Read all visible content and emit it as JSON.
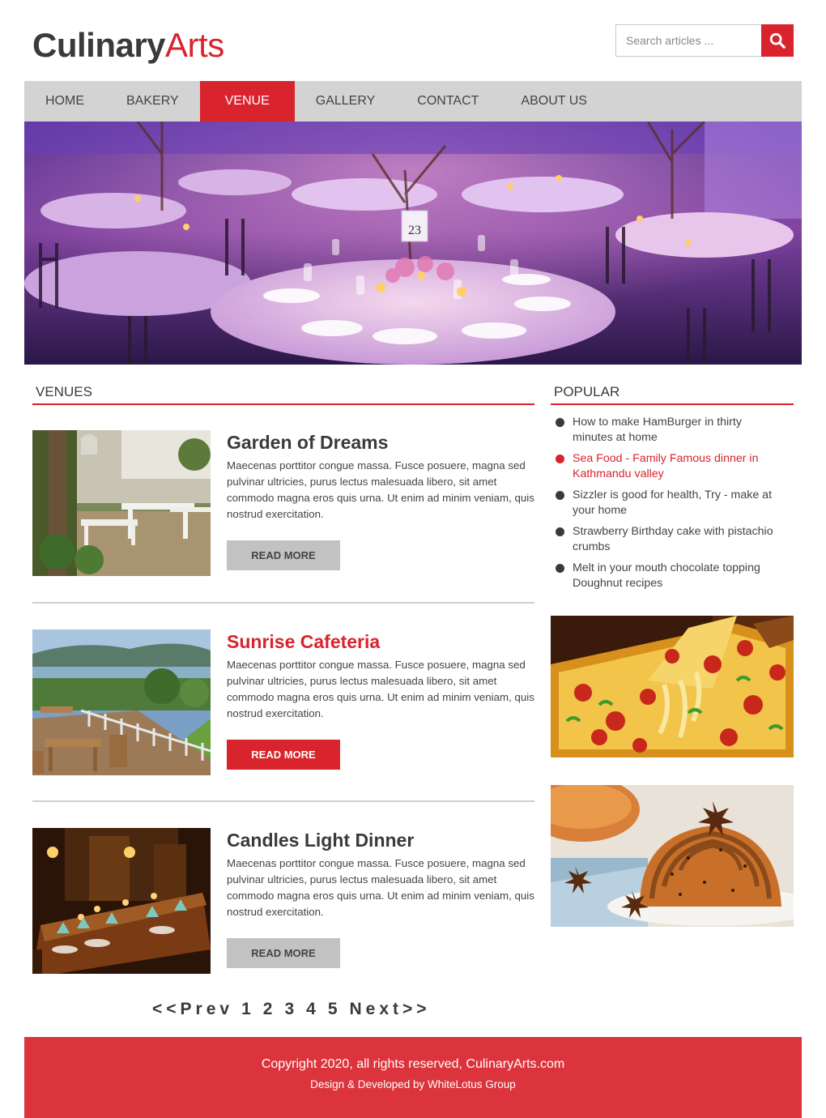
{
  "brand": {
    "part1": "Culinary",
    "part2": "Arts"
  },
  "search": {
    "placeholder": "Search articles ..."
  },
  "nav": [
    {
      "label": "HOME"
    },
    {
      "label": "BAKERY"
    },
    {
      "label": "VENUE"
    },
    {
      "label": "GALLERY"
    },
    {
      "label": "CONTACT"
    },
    {
      "label": "ABOUT US"
    }
  ],
  "venues_heading": "VENUES",
  "popular_heading": "POPULAR",
  "venues": [
    {
      "title": "Garden of Dreams",
      "text": "Maecenas porttitor congue massa. Fusce posuere, magna sed pulvinar ultricies, purus lectus malesuada libero, sit amet commodo magna eros quis urna. Ut enim ad minim veniam, quis nostrud exercitation.",
      "button": "READ MORE"
    },
    {
      "title": "Sunrise Cafeteria",
      "text": "Maecenas porttitor congue massa. Fusce posuere, magna sed pulvinar ultricies, purus lectus malesuada libero, sit amet commodo magna eros quis urna. Ut enim ad minim veniam, quis nostrud exercitation.",
      "button": "READ MORE"
    },
    {
      "title": "Candles Light Dinner",
      "text": "Maecenas porttitor congue massa. Fusce posuere, magna sed pulvinar ultricies, purus lectus malesuada libero, sit amet commodo magna eros quis urna. Ut enim ad minim veniam, quis nostrud exercitation.",
      "button": "READ MORE"
    }
  ],
  "popular": [
    "How to make HamBurger in thirty minutes at home",
    "Sea Food - Family Famous dinner in Kathmandu valley",
    "Sizzler is good for health, Try - make at your home",
    "Strawberry Birthday cake with pistachio crumbs",
    "Melt in your mouth chocolate topping Doughnut recipes"
  ],
  "pagination": {
    "prev": "<<Prev",
    "pages": [
      "1",
      "2",
      "3",
      "4",
      "5"
    ],
    "next": "Next>>"
  },
  "footer": {
    "copyright": "Copyright 2020, all rights reserved, CulinaryArts.com",
    "credit": "Design & Developed by WhiteLotus Group"
  },
  "hero_table_number": "23",
  "colors": {
    "accent": "#d9232d",
    "nav_bg": "#d3d3d3",
    "footer_bg": "#dc343c",
    "text": "#444444",
    "button_gray": "#c2c2c2"
  }
}
